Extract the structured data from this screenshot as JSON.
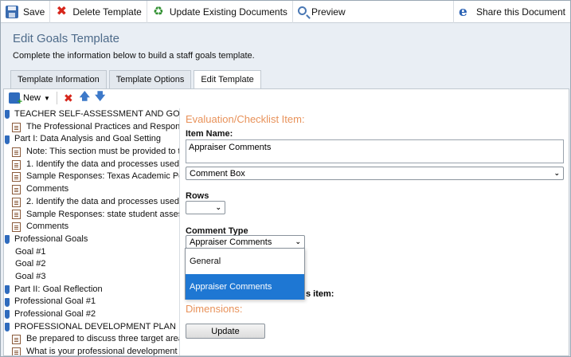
{
  "toolbar": {
    "save": "Save",
    "delete_template": "Delete Template",
    "update_existing": "Update Existing Documents",
    "preview": "Preview",
    "share": "Share this Document"
  },
  "page": {
    "title": "Edit Goals Template",
    "subtitle": "Complete the information below to build a staff goals template."
  },
  "tabs": [
    {
      "label": "Template Information",
      "active": false
    },
    {
      "label": "Template Options",
      "active": false
    },
    {
      "label": "Edit Template",
      "active": true
    }
  ],
  "sub_toolbar": {
    "new_label": "New"
  },
  "tree": [
    {
      "type": "folder",
      "label": "TEACHER SELF-ASSESSMENT AND GOAL SETTING"
    },
    {
      "type": "doc",
      "label": "The Professional Practices and Responsibilities"
    },
    {
      "type": "folder",
      "label": "Part I: Data Analysis and Goal Setting"
    },
    {
      "type": "doc",
      "label": "Note: This section must be provided to the"
    },
    {
      "type": "doc",
      "label": "1. Identify the data and processes used"
    },
    {
      "type": "doc",
      "label": "Sample Responses: Texas Academic Performance"
    },
    {
      "type": "doc",
      "label": "Comments"
    },
    {
      "type": "doc",
      "label": "2. Identify the data and processes used"
    },
    {
      "type": "doc",
      "label": "Sample Responses: state student assessment"
    },
    {
      "type": "doc",
      "label": "Comments"
    },
    {
      "type": "folder",
      "label": "Professional Goals"
    },
    {
      "type": "plain",
      "label": "Goal #1"
    },
    {
      "type": "plain",
      "label": "Goal #2"
    },
    {
      "type": "plain",
      "label": "Goal #3"
    },
    {
      "type": "folder",
      "label": "Part II: Goal Reflection"
    },
    {
      "type": "folder",
      "label": "Professional Goal #1"
    },
    {
      "type": "folder",
      "label": "Professional Goal #2"
    },
    {
      "type": "folder",
      "label": "PROFESSIONAL DEVELOPMENT PLAN"
    },
    {
      "type": "doc",
      "label": "Be prepared to discuss three target areas"
    },
    {
      "type": "doc",
      "label": "What is your professional development plan"
    }
  ],
  "form": {
    "section_heading": "Evaluation/Checklist Item:",
    "item_name_label": "Item Name:",
    "item_name_value": "Appraiser Comments",
    "item_type_value": "Comment Box",
    "rows_label": "Rows",
    "rows_value": "",
    "comment_type_label": "Comment Type",
    "comment_type_value": "Appraiser Comments",
    "comment_type_options": [
      "General",
      "Appraiser Comments"
    ],
    "partially_hidden_label": "s item:",
    "dimensions_heading": "Dimensions:",
    "update_button": "Update"
  },
  "colors": {
    "accent_orange": "#e8925a",
    "title_blue": "#4e6b8a",
    "selection_blue": "#1e77d3"
  }
}
